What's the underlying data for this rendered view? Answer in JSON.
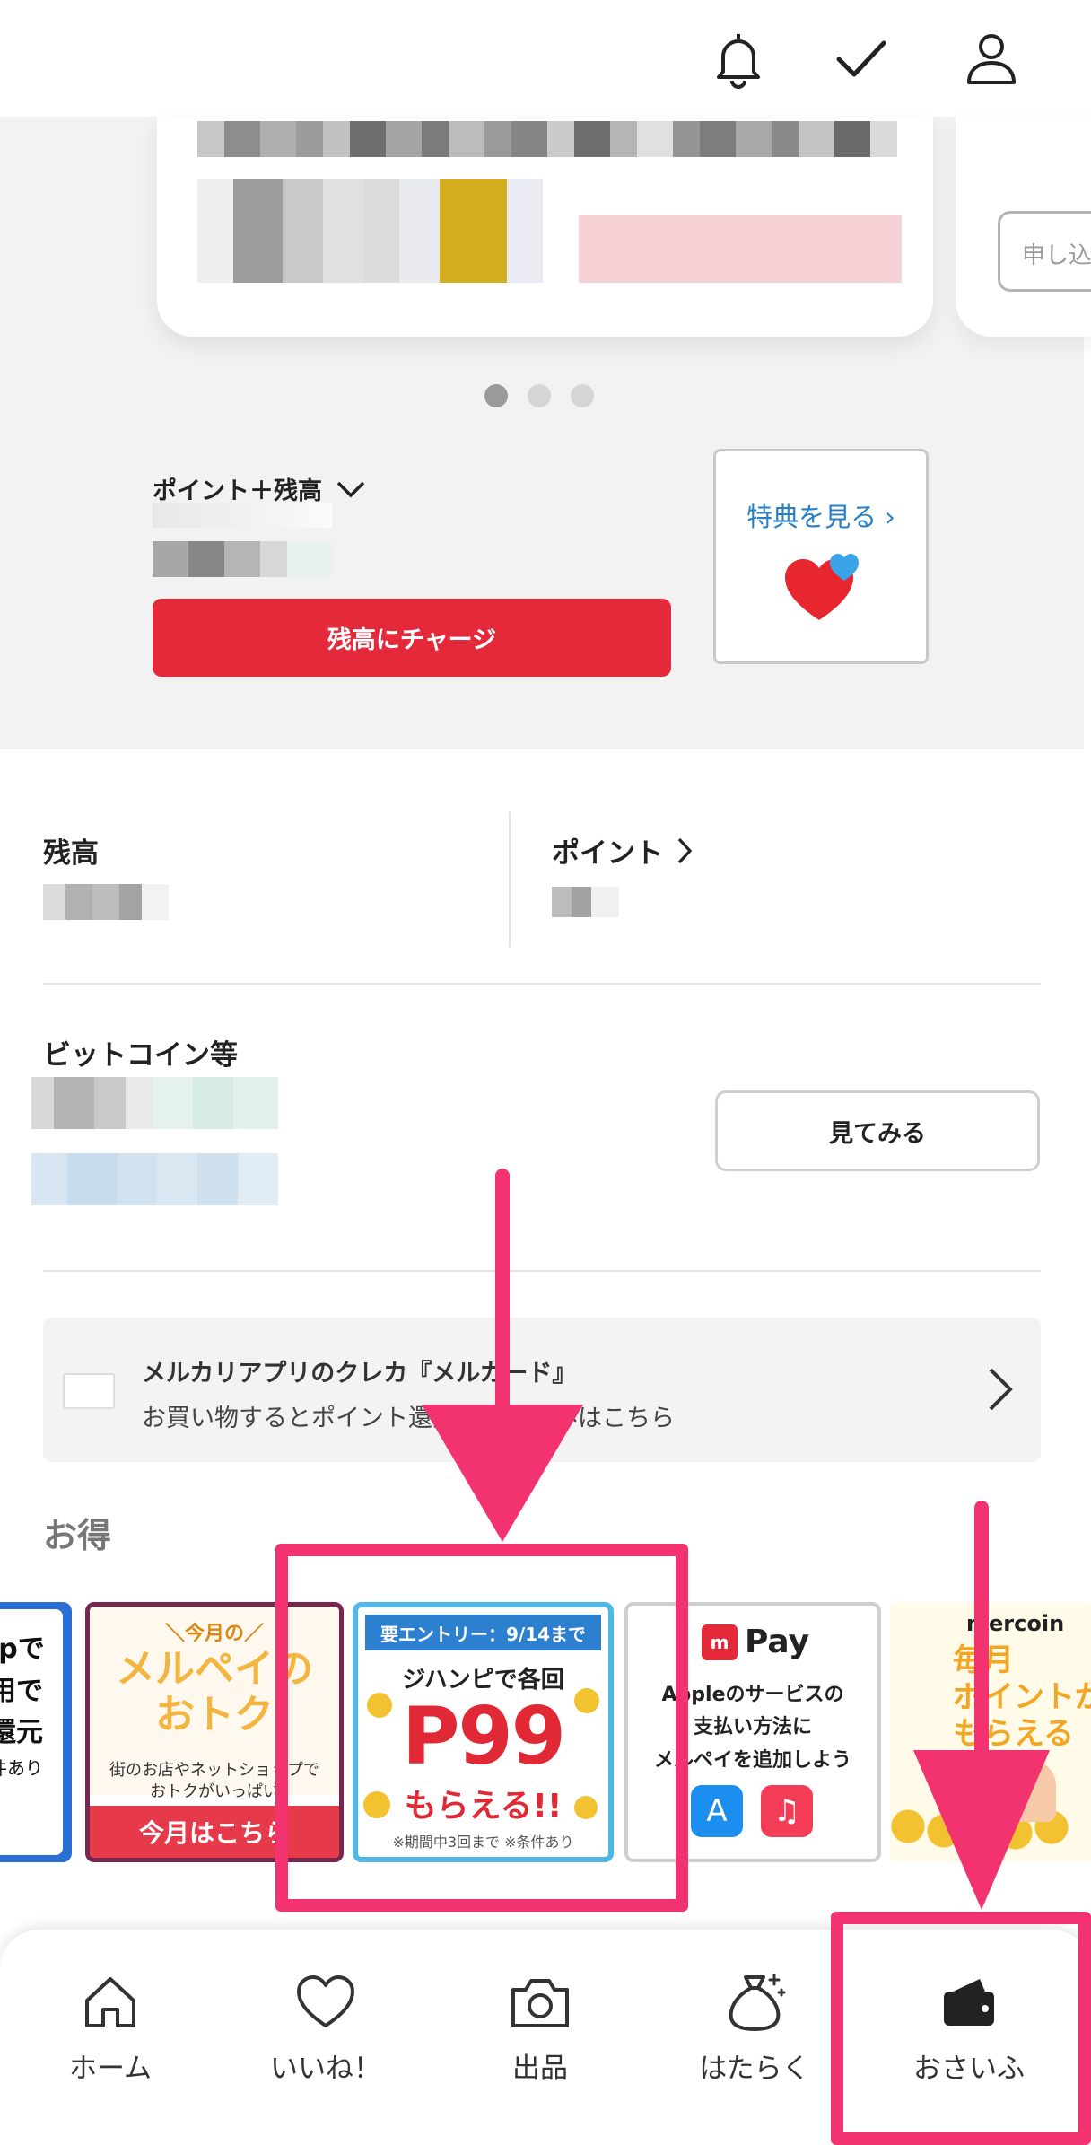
{
  "hero": {
    "apply_button": "申し込",
    "points_balance_label": "ポイント＋残高",
    "charge_button": "残高にチャージ",
    "perks_link": "特典を見る"
  },
  "balance": {
    "zandaka_label": "残高",
    "point_label": "ポイント"
  },
  "crypto": {
    "label": "ビットコイン等",
    "see_button": "見てみる"
  },
  "card_banner": {
    "title": "メルカリアプリのクレカ『メルカード』",
    "subtitle": "お買い物するとポイント還元。お申込みはこちら"
  },
  "otoku_heading": "お得",
  "promos": {
    "t1": {
      "line1": "jpで",
      "line2": "用で",
      "line3": "還元",
      "line4": "件あり"
    },
    "t2": {
      "tag": "＼今月の／",
      "line1": "メルペイの",
      "line2": "おトク",
      "desc1": "街のお店やネットショップで",
      "desc2": "おトクがいっぱい",
      "cta": "今月はこちら"
    },
    "t3": {
      "header": "要エントリー：9/14まで",
      "line1": "ジハンピで各回",
      "big": "P99",
      "line2": "もらえる!!",
      "note": "※期間中3回まで ※条件あり"
    },
    "t4": {
      "brand": "Pay",
      "line1": "Appleのサービスの",
      "line2": "支払い方法に",
      "line3": "メルペイを追加しよう"
    },
    "t5": {
      "brand": "mercoin",
      "line1": "毎月",
      "line2": "ポイントが",
      "line3": "もらえる"
    }
  },
  "bottom_nav": [
    {
      "label": "ホーム",
      "icon": "home-icon"
    },
    {
      "label": "いいね！",
      "icon": "heart-icon"
    },
    {
      "label": "出品",
      "icon": "camera-icon"
    },
    {
      "label": "はたらく",
      "icon": "money-bag-icon"
    },
    {
      "label": "おさいふ",
      "icon": "wallet-icon"
    }
  ],
  "colors": {
    "charge_red": "#e3293a",
    "annotation_pink": "#f3336f",
    "link_blue": "#2a7fc4",
    "merpay_blue": "#4fb8e6"
  }
}
